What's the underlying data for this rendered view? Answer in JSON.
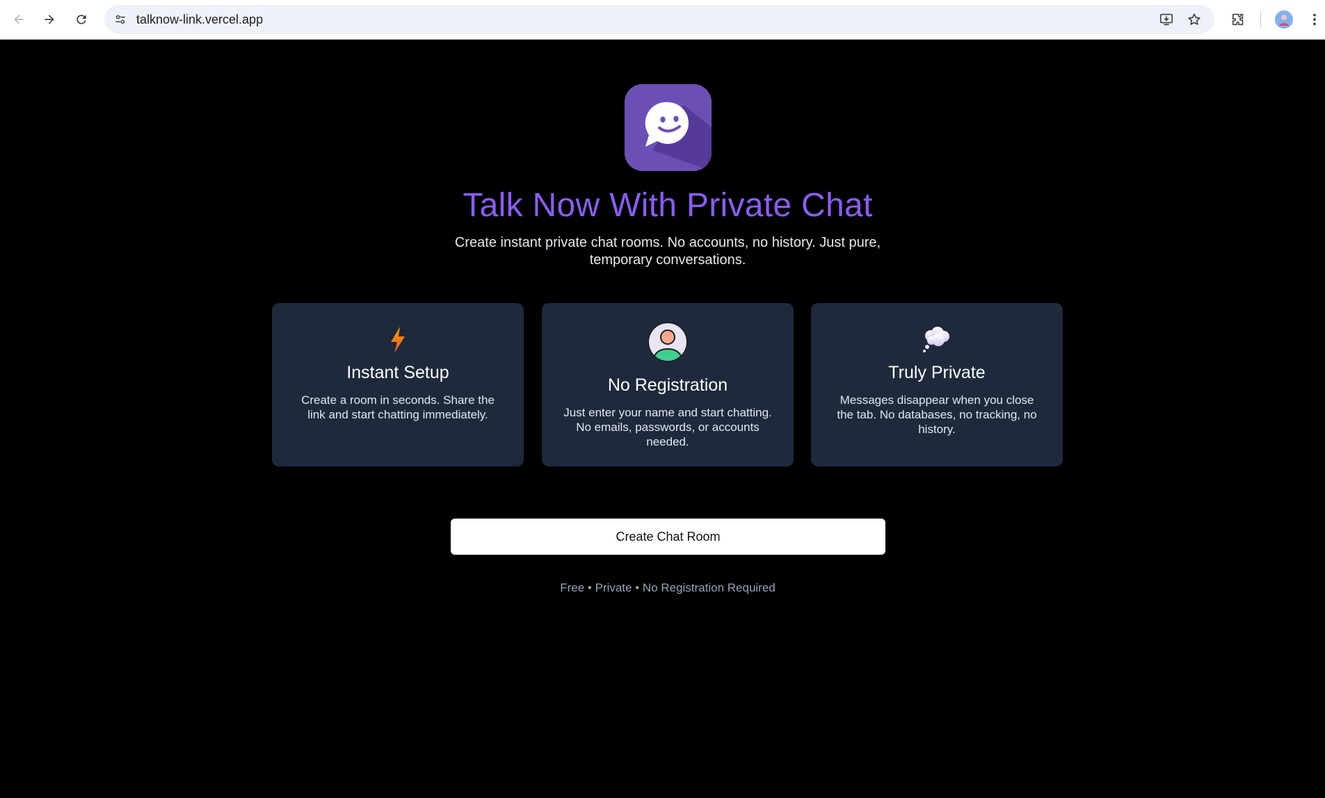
{
  "browser": {
    "url": "talknow-link.vercel.app"
  },
  "hero": {
    "title": "Talk Now With Private Chat",
    "subtitle": "Create instant private chat rooms. No accounts, no history. Just pure, temporary conversations."
  },
  "features": [
    {
      "icon": "lightning-icon",
      "title": "Instant Setup",
      "description": "Create a room in seconds. Share the link and start chatting immediately."
    },
    {
      "icon": "person-icon",
      "title": "No Registration",
      "description": "Just enter your name and start chatting. No emails, passwords, or accounts needed."
    },
    {
      "icon": "thought-bubble-icon",
      "title": "Truly Private",
      "description": "Messages disappear when you close the tab. No databases, no tracking, no history."
    }
  ],
  "cta": {
    "label": "Create Chat Room"
  },
  "footer": {
    "note": "Free • Private • No Registration Required"
  },
  "colors": {
    "accent": "#8b5cf6",
    "card_bg": "#1e293b",
    "page_bg": "#000000",
    "logo_bg": "#6b4fb4"
  }
}
